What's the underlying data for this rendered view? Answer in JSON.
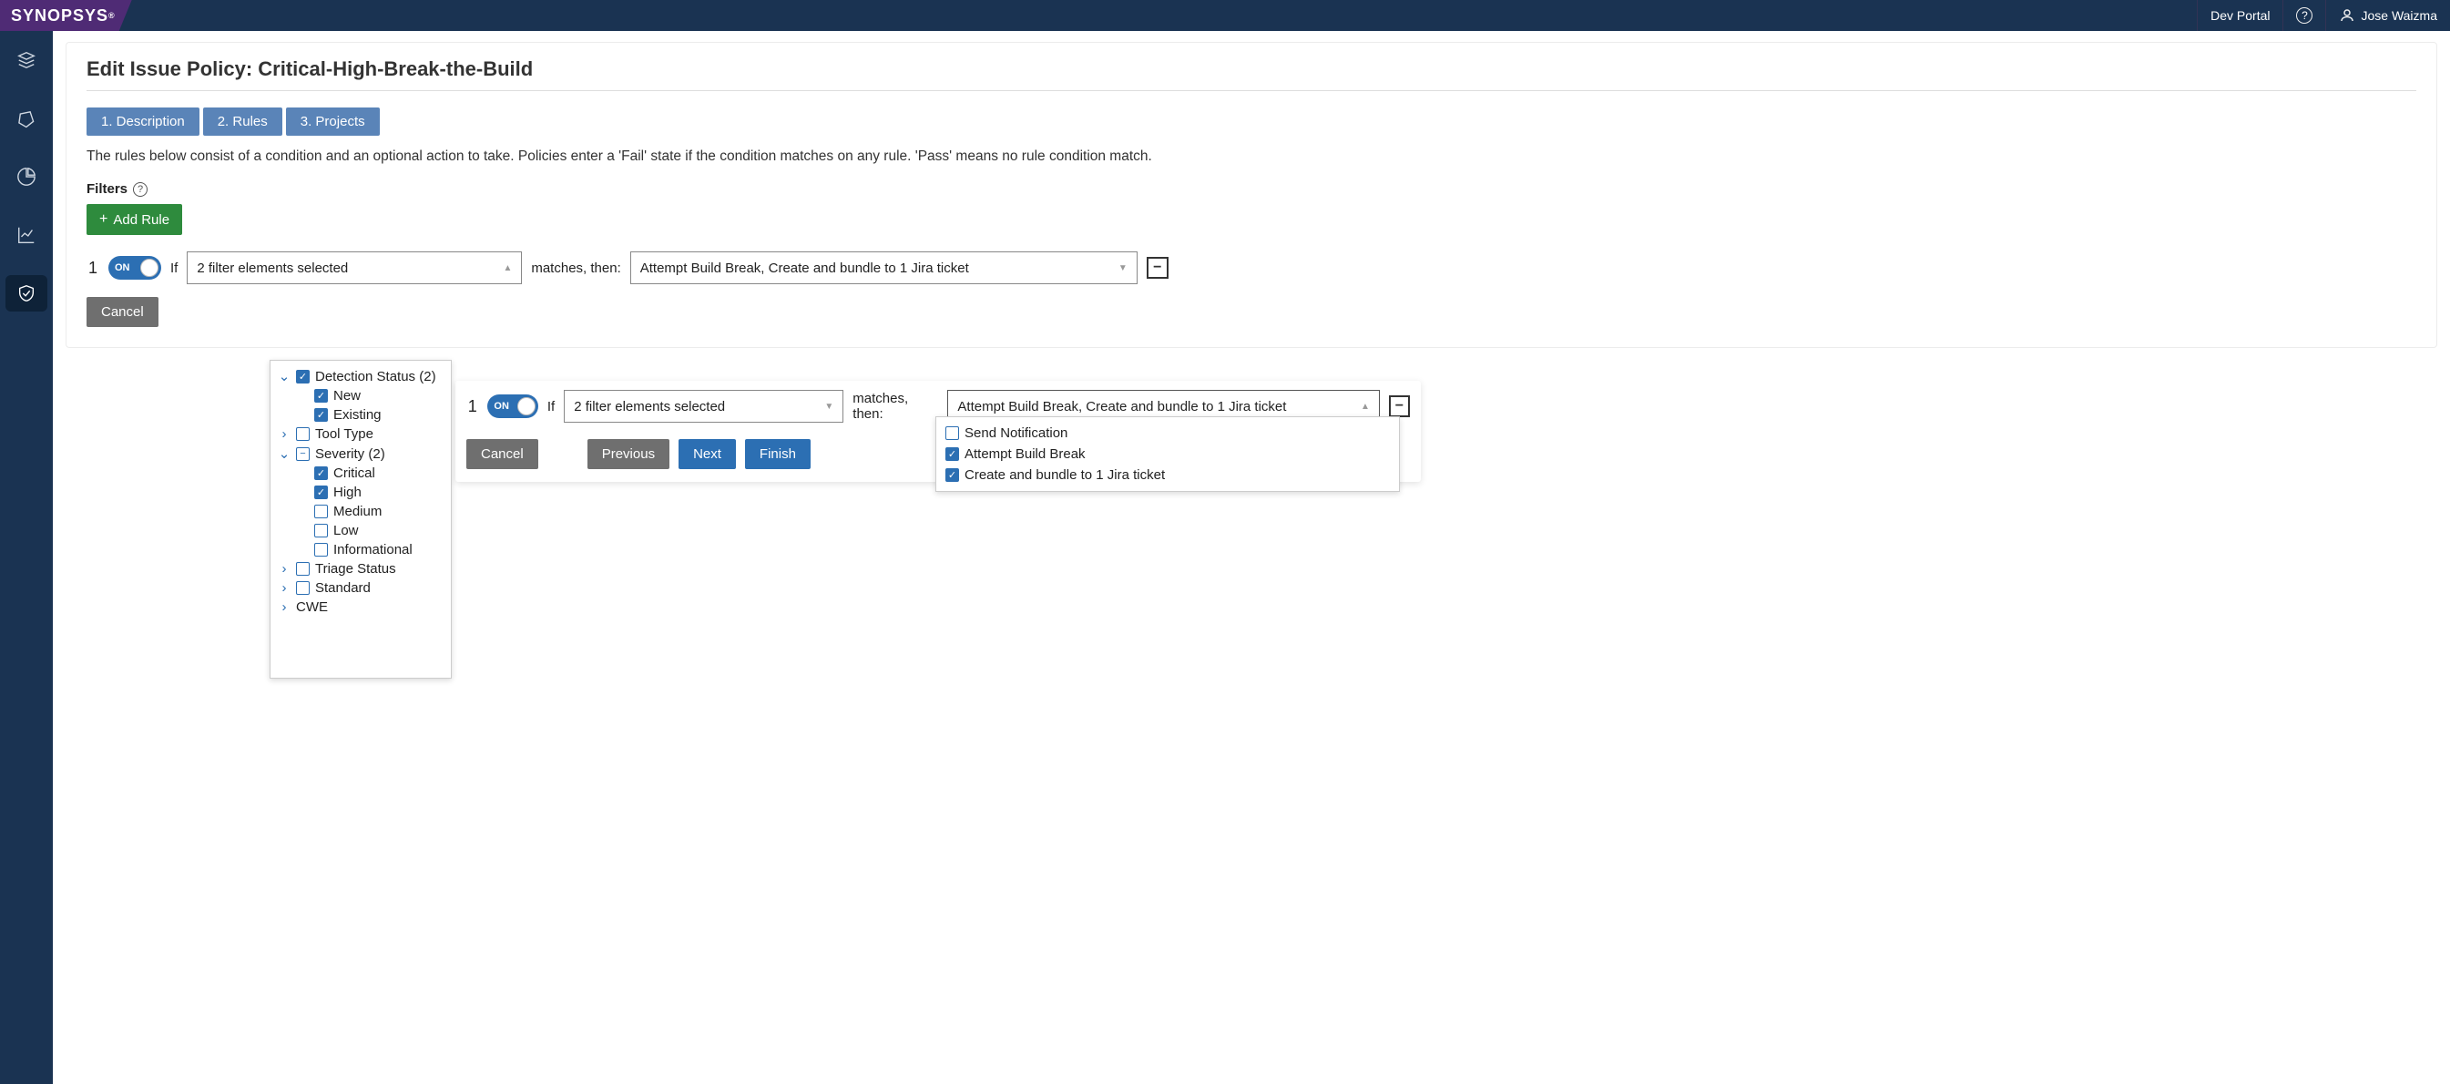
{
  "brand": "SYNOPSYS",
  "header": {
    "dev_portal": "Dev Portal",
    "user": "Jose Waizma"
  },
  "page": {
    "title": "Edit Issue Policy: Critical-High-Break-the-Build",
    "tabs": [
      "1. Description",
      "2. Rules",
      "3. Projects"
    ],
    "description": "The rules below consist of a condition and an optional action to take. Policies enter a 'Fail' state if the condition matches on any rule. 'Pass' means no rule condition match.",
    "filters_label": "Filters",
    "add_rule_label": "Add Rule"
  },
  "rule": {
    "number": "1",
    "toggle": "ON",
    "if": "If",
    "filter_summary": "2 filter elements selected",
    "matches": "matches, then:",
    "action_summary": "Attempt Build Break, Create and bundle to 1 Jira ticket"
  },
  "buttons": {
    "cancel": "Cancel",
    "previous": "Previous",
    "next": "Next",
    "finish": "Finish"
  },
  "filter_tree": {
    "detection_status": {
      "label": "Detection Status (2)",
      "new": "New",
      "existing": "Existing"
    },
    "tool_type": "Tool Type",
    "severity": {
      "label": "Severity (2)",
      "critical": "Critical",
      "high": "High",
      "medium": "Medium",
      "low": "Low",
      "informational": "Informational"
    },
    "triage_status": "Triage Status",
    "standard": "Standard",
    "cwe": "CWE"
  },
  "actions_tree": {
    "send_notification": "Send Notification",
    "attempt_break": "Attempt Build Break",
    "jira": "Create and bundle to 1 Jira ticket"
  }
}
